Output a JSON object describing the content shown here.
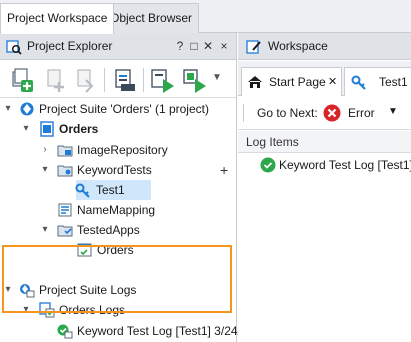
{
  "top_tabs": [
    "Project Workspace",
    "Object Browser"
  ],
  "explorer": {
    "title": "Project Explorer",
    "controls": [
      "?",
      "□",
      "✕",
      "×"
    ]
  },
  "tree": {
    "suite": "Project Suite 'Orders' (1 project)",
    "orders": "Orders",
    "image_repository": "ImageRepository",
    "keyword_tests": "KeywordTests",
    "add": "+",
    "test1": "Test1",
    "name_mapping": "NameMapping",
    "tested_apps": "TestedApps",
    "orders_app": "Orders",
    "suite_logs": "Project Suite Logs",
    "orders_logs": "Orders Logs",
    "log_entry": "Keyword Test Log [Test1] 3/24/"
  },
  "workspace": {
    "title": "Workspace",
    "tabs": [
      "Start Page",
      "Test1"
    ],
    "tab_close": "✕",
    "goto_label": "Go to Next:",
    "goto_value": "Error",
    "dropdown": "▼",
    "log_header": "Log Items",
    "log_item": "Keyword Test Log [Test1]"
  },
  "colors": {
    "accent": "#1e7bd6",
    "highlight": "#f7941d",
    "selection": "#cfe6fb",
    "ok": "#2aa84a",
    "error": "#d9252a"
  }
}
